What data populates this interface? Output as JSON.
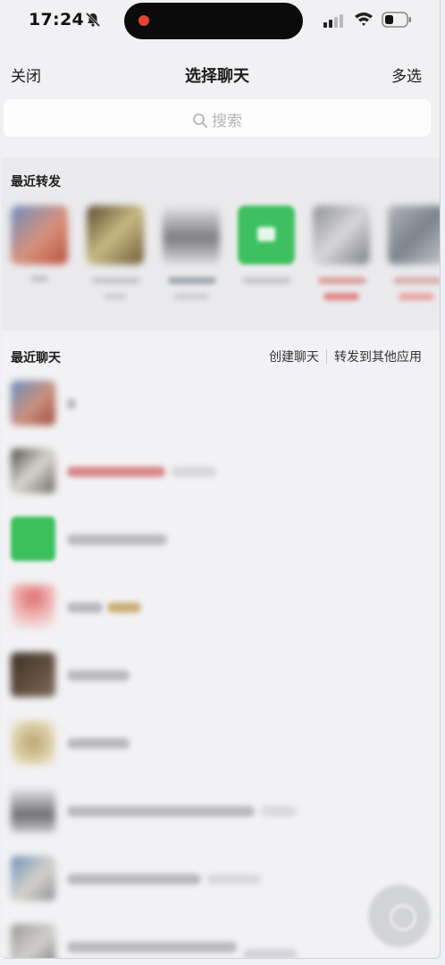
{
  "status_bar": {
    "time": "17:24",
    "icons": [
      "bell-slash-icon",
      "cellular-signal-icon",
      "wifi-icon",
      "battery-icon"
    ],
    "recording_color": "#e2482c"
  },
  "nav": {
    "close_label": "关闭",
    "title": "选择聊天",
    "multi_select_label": "多选"
  },
  "search": {
    "placeholder": "搜索",
    "icon": "search-icon"
  },
  "recent_forward": {
    "title": "最近转发",
    "items": [
      {
        "avatar_color": "#c98f7a"
      },
      {
        "avatar_color": "#8a7552"
      },
      {
        "avatar_color": "#9a9a9e"
      },
      {
        "avatar_color": "#3fc060"
      },
      {
        "avatar_color": "#a4a7b0"
      },
      {
        "avatar_color": "#9fa4ab"
      }
    ]
  },
  "recent_chats": {
    "title": "最近聊天",
    "create_chat_label": "创建聊天",
    "forward_other_apps_label": "转发到其他应用",
    "rows": [
      {
        "avatar_color": "#b7897e"
      },
      {
        "avatar_color": "#8e8a86"
      },
      {
        "avatar_color": "#3cc05e"
      },
      {
        "avatar_color": "#d47c7c"
      },
      {
        "avatar_color": "#5b4a3c"
      },
      {
        "avatar_color": "#c6b184"
      },
      {
        "avatar_color": "#9c9ca2"
      },
      {
        "avatar_color": "#8d98a8"
      },
      {
        "avatar_color": "#a8a6a4"
      }
    ]
  },
  "colors": {
    "background": "#f1f1f3",
    "wechat_green": "#3fc060"
  }
}
